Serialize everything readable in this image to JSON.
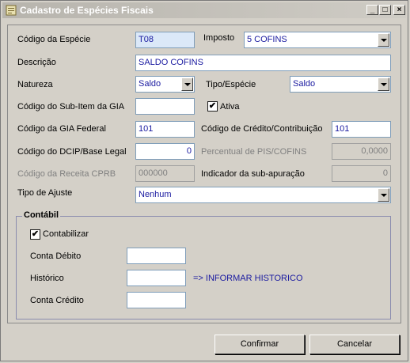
{
  "window": {
    "title": "Cadastro de Espécies Fiscais",
    "min_glyph": "_",
    "max_glyph": "□",
    "close_glyph": "×"
  },
  "form": {
    "codigo_especie_label": "Código da Espécie",
    "codigo_especie_value": "T08",
    "imposto_label": "Imposto",
    "imposto_value": "5 COFINS",
    "descricao_label": "Descrição",
    "descricao_value": "SALDO COFINS",
    "natureza_label": "Natureza",
    "natureza_value": "Saldo",
    "tipo_especie_label": "Tipo/Espécie",
    "tipo_especie_value": "Saldo",
    "subitem_gia_label": "Código do Sub-Item da GIA",
    "subitem_gia_value": "",
    "ativa_label": "Ativa",
    "ativa_checked": true,
    "gia_federal_label": "Código da GIA Federal",
    "gia_federal_value": "101",
    "credito_contrib_label": "Código de Crédito/Contribuição",
    "credito_contrib_value": "101",
    "dcip_label": "Código do DCIP/Base Legal",
    "dcip_value": "0",
    "percentual_label": "Percentual de PIS/COFINS",
    "percentual_value": "0,0000",
    "receita_cprb_label": "Código da Receita CPRB",
    "receita_cprb_value": "000000",
    "sub_apuracao_label": "Indicador da sub-apuração",
    "sub_apuracao_value": "0",
    "tipo_ajuste_label": "Tipo de Ajuste",
    "tipo_ajuste_value": "Nenhum"
  },
  "contabil": {
    "group_label": "Contábil",
    "contabilizar_label": "Contabilizar",
    "contabilizar_checked": true,
    "conta_debito_label": "Conta Débito",
    "conta_debito_value": "",
    "historico_label": "Histórico",
    "historico_value": "",
    "historico_hint": "=> INFORMAR HISTORICO",
    "conta_credito_label": "Conta Crédito",
    "conta_credito_value": ""
  },
  "buttons": {
    "confirmar": "Confirmar",
    "cancelar": "Cancelar"
  },
  "check_glyph": "✔"
}
